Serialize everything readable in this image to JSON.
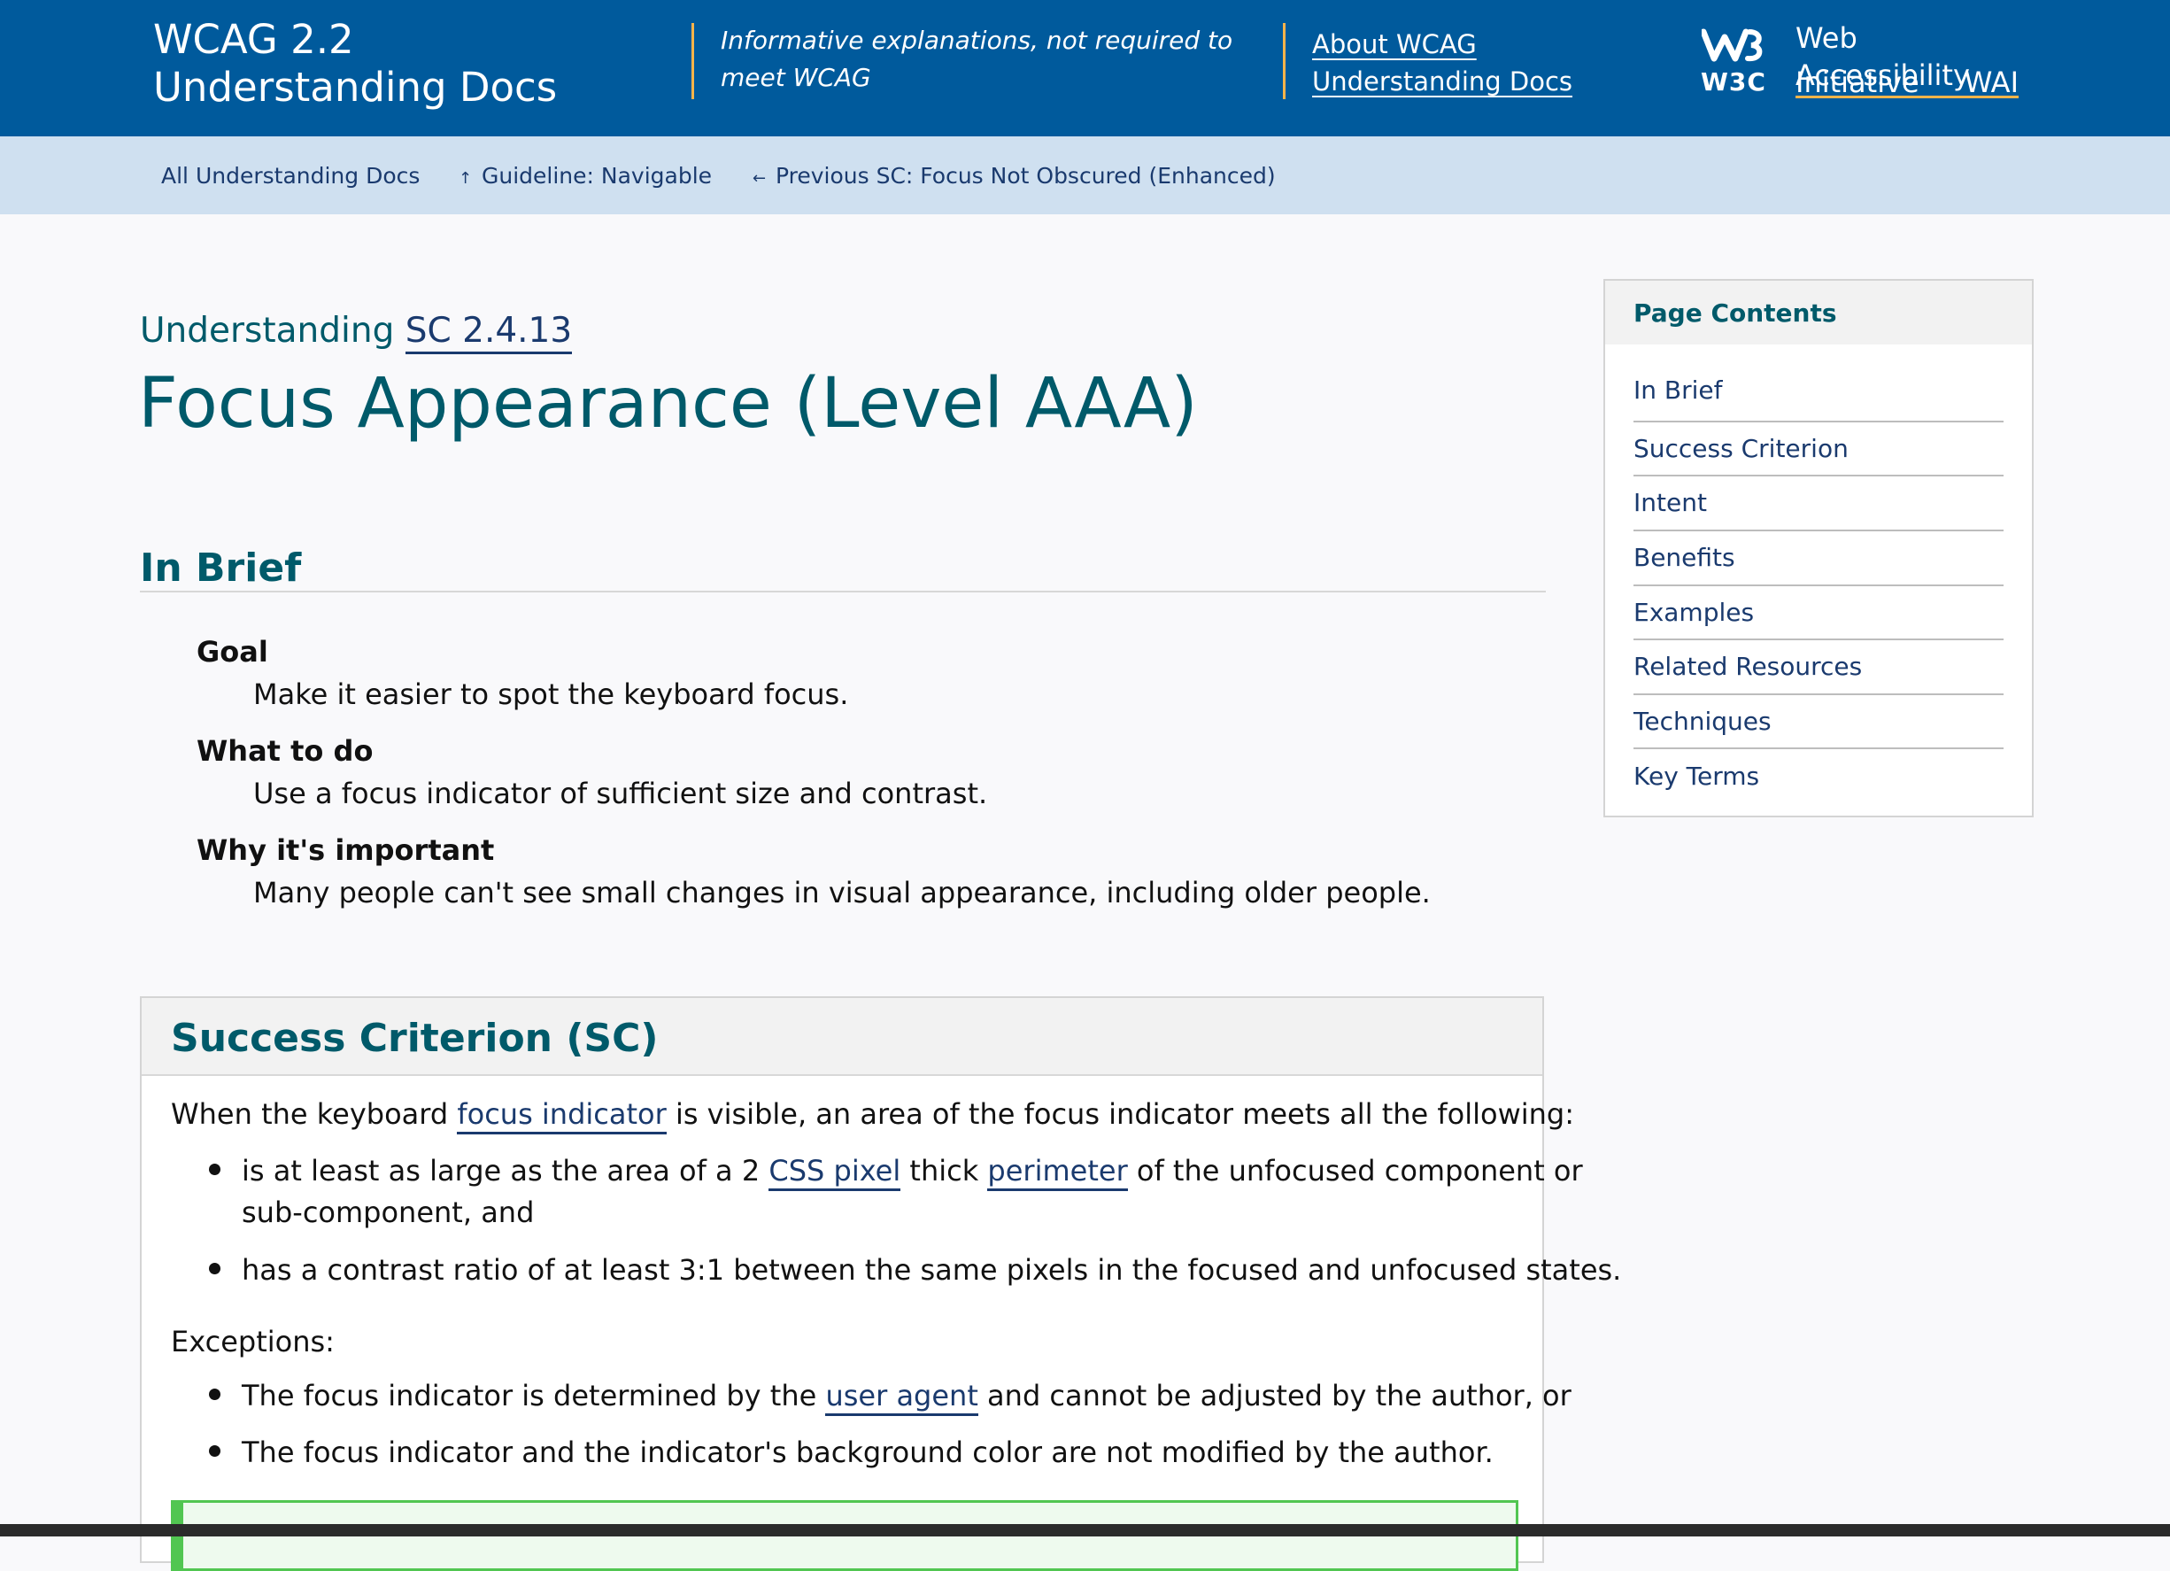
{
  "header": {
    "title": "WCAG 2.2 Understanding Docs",
    "tagline": "Informative explanations, not required to meet WCAG",
    "about_link": "About WCAG Understanding Docs",
    "w3c_label": "W3C",
    "wai_line1": "Web Accessibility",
    "wai_initiative": "Initiative",
    "wai_abbr": "WAI",
    "logo_icon": "w3c-logo-icon"
  },
  "breadcrumbs": [
    {
      "label": "All Understanding Docs",
      "icon": ""
    },
    {
      "label": "Guideline: Navigable",
      "icon": "arrow-up-icon"
    },
    {
      "label": "Previous SC: Focus Not Obscured (Enhanced)",
      "icon": "arrow-left-icon"
    }
  ],
  "heading": {
    "prefix": "Understanding",
    "sc_link": "SC 2.4.13",
    "title": "Focus Appearance (Level AAA)"
  },
  "in_brief": {
    "heading": "In Brief",
    "items": [
      {
        "term": "Goal",
        "definition": "Make it easier to spot the keyboard focus."
      },
      {
        "term": "What to do",
        "definition": "Use a focus indicator of sufficient size and contrast."
      },
      {
        "term": "Why it's important",
        "definition": "Many people can't see small changes in visual appearance, including older people."
      }
    ]
  },
  "success_criterion": {
    "heading": "Success Criterion (SC)",
    "intro_before": "When the keyboard ",
    "intro_link": "focus indicator",
    "intro_after": " is visible, an area of the focus indicator meets all the following:",
    "bullet1_a": "is at least as large as the area of a 2 ",
    "bullet1_link1": "CSS pixel",
    "bullet1_b": " thick ",
    "bullet1_link2": "perimeter",
    "bullet1_c": " of the unfocused component or",
    "bullet1_d": "sub-component, and",
    "bullet2": "has a contrast ratio of at least 3:1 between the same pixels in the focused and unfocused states.",
    "exceptions_label": "Exceptions:",
    "exc1_a": "The focus indicator is determined by the ",
    "exc1_link": "user agent",
    "exc1_b": " and cannot be adjusted by the author, or",
    "exc2": "The focus indicator and the indicator's background color are not modified by the author."
  },
  "toc": {
    "title": "Page Contents",
    "items": [
      "In Brief",
      "Success Criterion",
      "Intent",
      "Benefits",
      "Examples",
      "Related Resources",
      "Techniques",
      "Key Terms"
    ]
  },
  "colors": {
    "header_bg": "#005a9c",
    "accent_gold": "#fcb44a",
    "breadcrumb_bg": "#cfe0f0",
    "heading_teal": "#005a6a",
    "link_navy": "#1a3a6e",
    "note_green": "#51c651"
  }
}
